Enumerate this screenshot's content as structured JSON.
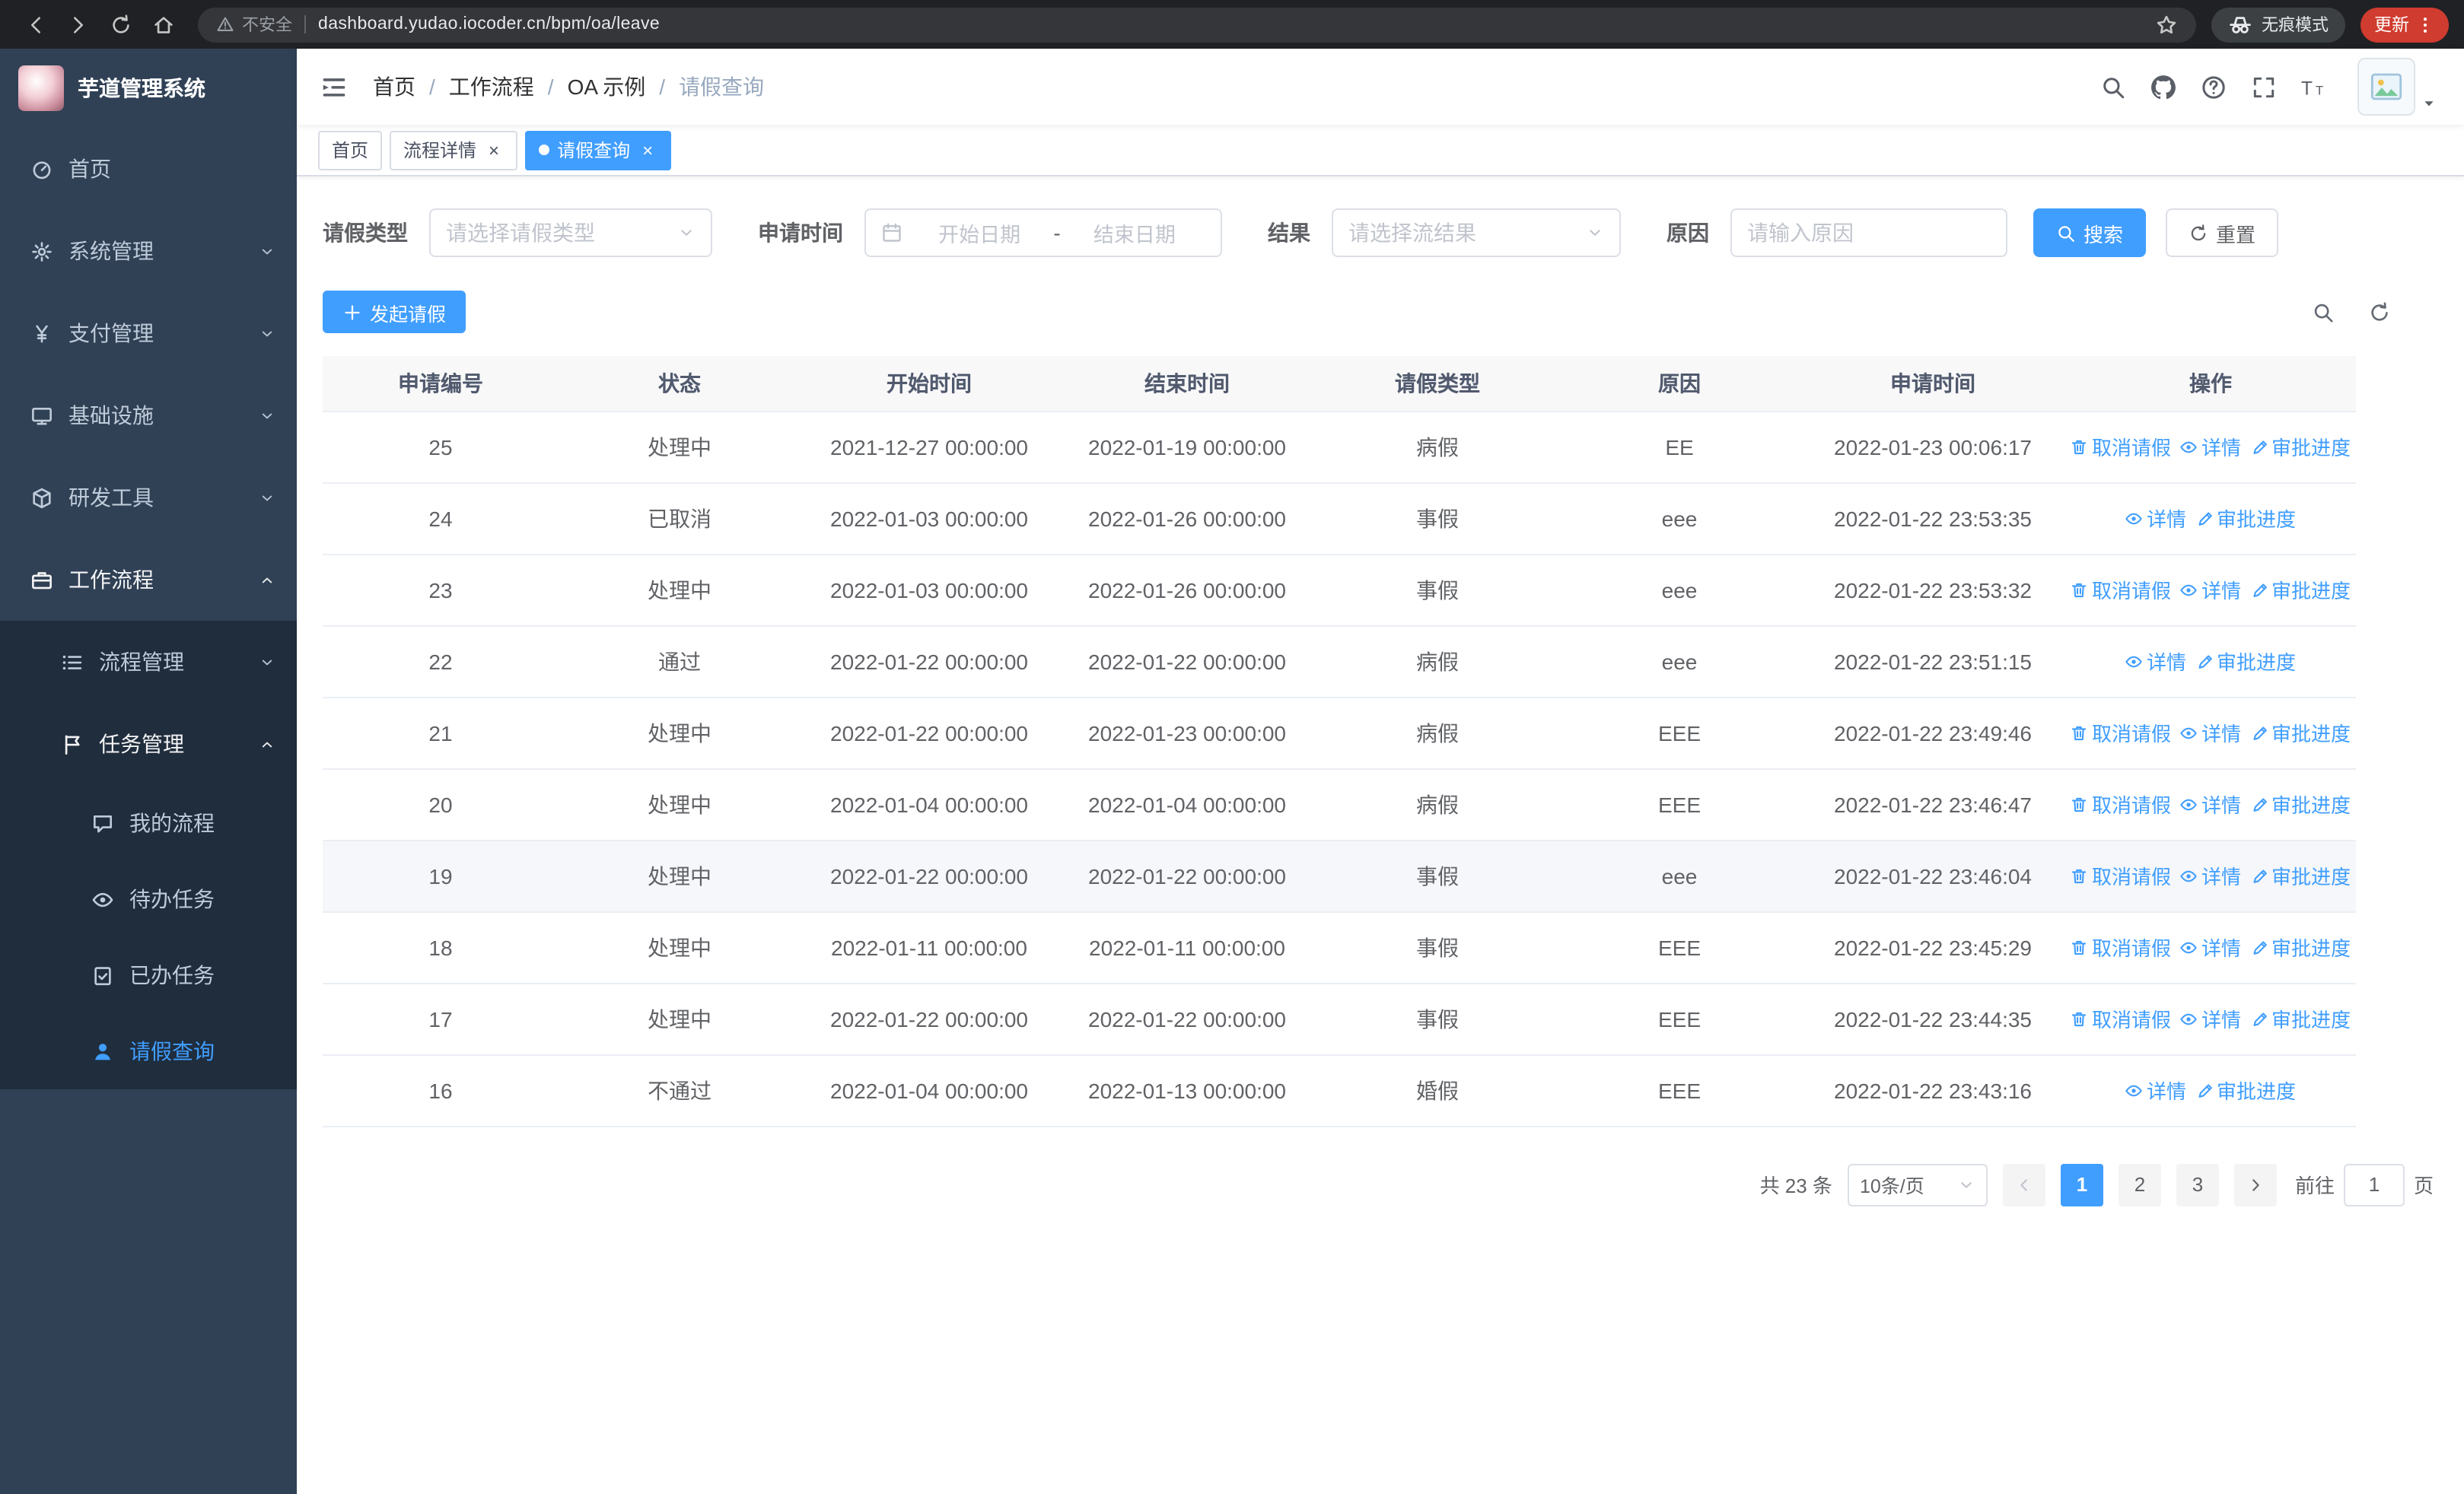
{
  "colors": {
    "accent": "#409eff",
    "sidebar_bg": "#304156",
    "submenu_bg": "#1f2d3d",
    "active_tab_bg": "#409eff",
    "update_pill_bg": "#d03c2f",
    "table_header_bg": "#f8f8f9"
  },
  "browser": {
    "security_label": "不安全",
    "url": "dashboard.yudao.iocoder.cn/bpm/oa/leave",
    "incognito_label": "无痕模式",
    "update_label": "更新"
  },
  "sidebar": {
    "app_title": "芋道管理系统",
    "menu": [
      {
        "name": "home",
        "label": "首页",
        "icon": "dashboard-icon"
      },
      {
        "name": "system-management",
        "label": "系统管理",
        "icon": "gear-icon",
        "arrow": "down"
      },
      {
        "name": "payment-management",
        "label": "支付管理",
        "icon": "yen-icon",
        "arrow": "down"
      },
      {
        "name": "infrastructure",
        "label": "基础设施",
        "icon": "monitor-icon",
        "arrow": "down"
      },
      {
        "name": "dev-tools",
        "label": "研发工具",
        "icon": "cube-icon",
        "arrow": "down"
      },
      {
        "name": "workflow",
        "label": "工作流程",
        "icon": "briefcase-icon",
        "arrow": "up",
        "open": true
      }
    ],
    "workflow_children": [
      {
        "name": "process-management",
        "label": "流程管理",
        "icon": "list-icon",
        "arrow": "down",
        "level": 2
      },
      {
        "name": "task-management",
        "label": "任务管理",
        "icon": "flag-icon",
        "arrow": "up",
        "level": 2,
        "open": true
      },
      {
        "name": "my-process",
        "label": "我的流程",
        "icon": "chat-icon",
        "level": 3
      },
      {
        "name": "todo-task",
        "label": "待办任务",
        "icon": "eye-icon",
        "level": 3
      },
      {
        "name": "done-task",
        "label": "已办任务",
        "icon": "clipboard-icon",
        "level": 3
      },
      {
        "name": "leave-query",
        "label": "请假查询",
        "icon": "user-icon",
        "level": 3,
        "active": true
      }
    ]
  },
  "navbar": {
    "breadcrumb": [
      "首页",
      "工作流程",
      "OA 示例",
      "请假查询"
    ]
  },
  "tabs": [
    {
      "name": "home",
      "label": "首页"
    },
    {
      "name": "process-detail",
      "label": "流程详情",
      "closable": true
    },
    {
      "name": "leave-query",
      "label": "请假查询",
      "closable": true,
      "active": true
    }
  ],
  "filters": {
    "leave_type": {
      "label": "请假类型",
      "placeholder": "请选择请假类型"
    },
    "apply_time": {
      "label": "申请时间",
      "start_placeholder": "开始日期",
      "separator": "-",
      "end_placeholder": "结束日期"
    },
    "result": {
      "label": "结果",
      "placeholder": "请选择流结果"
    },
    "reason": {
      "label": "原因",
      "placeholder": "请输入原因"
    },
    "search_label": "搜索",
    "reset_label": "重置"
  },
  "toolbar": {
    "create_label": "发起请假"
  },
  "table": {
    "columns": [
      "申请编号",
      "状态",
      "开始时间",
      "结束时间",
      "请假类型",
      "原因",
      "申请时间",
      "操作"
    ],
    "action_defs": {
      "cancel": {
        "label": "取消请假",
        "icon": "trash-icon"
      },
      "detail": {
        "label": "详情",
        "icon": "eye-icon"
      },
      "progress": {
        "label": "审批进度",
        "icon": "edit-icon"
      }
    },
    "rows": [
      {
        "cells": [
          "25",
          "处理中",
          "2021-12-27 00:00:00",
          "2022-01-19 00:00:00",
          "病假",
          "EE",
          "2022-01-23 00:06:17"
        ],
        "actions": [
          "cancel",
          "detail",
          "progress"
        ]
      },
      {
        "cells": [
          "24",
          "已取消",
          "2022-01-03 00:00:00",
          "2022-01-26 00:00:00",
          "事假",
          "eee",
          "2022-01-22 23:53:35"
        ],
        "actions": [
          "detail",
          "progress"
        ]
      },
      {
        "cells": [
          "23",
          "处理中",
          "2022-01-03 00:00:00",
          "2022-01-26 00:00:00",
          "事假",
          "eee",
          "2022-01-22 23:53:32"
        ],
        "actions": [
          "cancel",
          "detail",
          "progress"
        ]
      },
      {
        "cells": [
          "22",
          "通过",
          "2022-01-22 00:00:00",
          "2022-01-22 00:00:00",
          "病假",
          "eee",
          "2022-01-22 23:51:15"
        ],
        "actions": [
          "detail",
          "progress"
        ]
      },
      {
        "cells": [
          "21",
          "处理中",
          "2022-01-22 00:00:00",
          "2022-01-23 00:00:00",
          "病假",
          "EEE",
          "2022-01-22 23:49:46"
        ],
        "actions": [
          "cancel",
          "detail",
          "progress"
        ]
      },
      {
        "cells": [
          "20",
          "处理中",
          "2022-01-04 00:00:00",
          "2022-01-04 00:00:00",
          "病假",
          "EEE",
          "2022-01-22 23:46:47"
        ],
        "actions": [
          "cancel",
          "detail",
          "progress"
        ]
      },
      {
        "cells": [
          "19",
          "处理中",
          "2022-01-22 00:00:00",
          "2022-01-22 00:00:00",
          "事假",
          "eee",
          "2022-01-22 23:46:04"
        ],
        "actions": [
          "cancel",
          "detail",
          "progress"
        ],
        "highlight": true
      },
      {
        "cells": [
          "18",
          "处理中",
          "2022-01-11 00:00:00",
          "2022-01-11 00:00:00",
          "事假",
          "EEE",
          "2022-01-22 23:45:29"
        ],
        "actions": [
          "cancel",
          "detail",
          "progress"
        ]
      },
      {
        "cells": [
          "17",
          "处理中",
          "2022-01-22 00:00:00",
          "2022-01-22 00:00:00",
          "事假",
          "EEE",
          "2022-01-22 23:44:35"
        ],
        "actions": [
          "cancel",
          "detail",
          "progress"
        ]
      },
      {
        "cells": [
          "16",
          "不通过",
          "2022-01-04 00:00:00",
          "2022-01-13 00:00:00",
          "婚假",
          "EEE",
          "2022-01-22 23:43:16"
        ],
        "actions": [
          "detail",
          "progress"
        ]
      }
    ]
  },
  "pagination": {
    "total_text": "共 23 条",
    "page_size": "10条/页",
    "pages": [
      "1",
      "2",
      "3"
    ],
    "active_page": "1",
    "goto_label": "前往",
    "goto_value": "1",
    "goto_suffix": "页"
  }
}
